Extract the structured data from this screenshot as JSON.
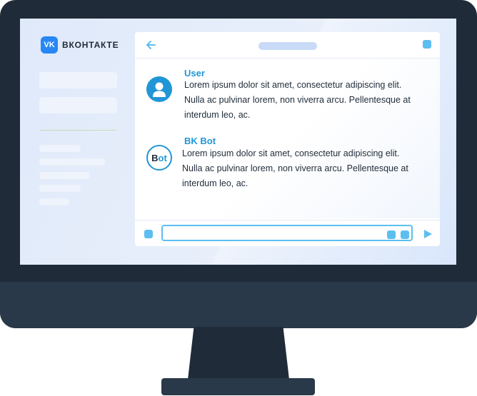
{
  "brand": {
    "logo_glyph": "VK",
    "name": "ВКОНТАКТЕ",
    "color": "#2787f5"
  },
  "messages": [
    {
      "sender": "User",
      "avatar_icon": "user-icon",
      "text": "Lorem ipsum dolor sit amet, consectetur adipiscing elit. Nulla ac pulvinar lorem, non viverra arcu. Pellentesque at interdum leo, ac."
    },
    {
      "sender": "BK Bot",
      "avatar_label_b": "B",
      "avatar_label_ot": "ot",
      "text": "Lorem ipsum dolor sit amet, consectetur adipiscing elit. Nulla ac pulvinar lorem, non viverra arcu. Pellentesque at interdum leo, ac."
    }
  ],
  "composer": {
    "value": "",
    "placeholder": ""
  },
  "colors": {
    "accent": "#2196d6",
    "accent_light": "#5cbef0",
    "bezel": "#1f2b39"
  },
  "icons": {
    "back": "arrow-left-icon",
    "send": "send-icon"
  }
}
